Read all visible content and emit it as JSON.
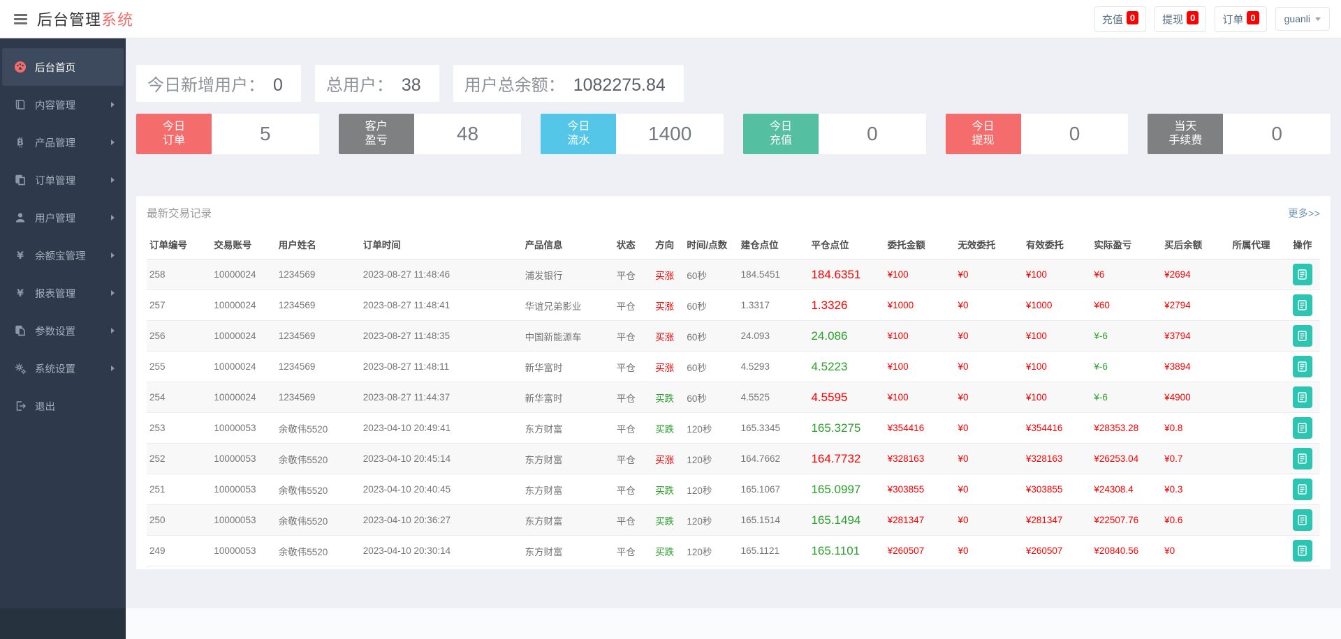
{
  "header": {
    "title_primary": "后台管理",
    "title_accent": "系统",
    "actions": [
      {
        "label": "充值",
        "badge": "0"
      },
      {
        "label": "提现",
        "badge": "0"
      },
      {
        "label": "订单",
        "badge": "0"
      }
    ],
    "user": "guanli"
  },
  "sidebar": {
    "items": [
      {
        "label": "后台首页",
        "icon": "dashboard-icon",
        "active": true,
        "arrow": false
      },
      {
        "label": "内容管理",
        "icon": "book-icon",
        "active": false,
        "arrow": true
      },
      {
        "label": "产品管理",
        "icon": "coin-icon",
        "active": false,
        "arrow": true
      },
      {
        "label": "订单管理",
        "icon": "orders-icon",
        "active": false,
        "arrow": true
      },
      {
        "label": "用户管理",
        "icon": "user-icon",
        "active": false,
        "arrow": true
      },
      {
        "label": "余额宝管理",
        "icon": "yuan-icon",
        "active": false,
        "arrow": true
      },
      {
        "label": "报表管理",
        "icon": "yuan-icon",
        "active": false,
        "arrow": true
      },
      {
        "label": "参数设置",
        "icon": "copy-icon",
        "active": false,
        "arrow": true
      },
      {
        "label": "系统设置",
        "icon": "gears-icon",
        "active": false,
        "arrow": true
      },
      {
        "label": "退出",
        "icon": "logout-icon",
        "active": false,
        "arrow": false
      }
    ]
  },
  "overview": {
    "stats": [
      {
        "label": "今日新增用户：",
        "value": "0"
      },
      {
        "label": "总用户：",
        "value": "38"
      },
      {
        "label": "用户总余额：",
        "value": "1082275.84"
      }
    ],
    "cards": [
      {
        "line1": "今日",
        "line2": "订单",
        "value": "5",
        "color": "#f56c6c"
      },
      {
        "line1": "客户",
        "line2": "盈亏",
        "value": "48",
        "color": "#7f8081"
      },
      {
        "line1": "今日",
        "line2": "流水",
        "value": "1400",
        "color": "#54c7e8"
      },
      {
        "line1": "今日",
        "line2": "充值",
        "value": "0",
        "color": "#55bfa2"
      },
      {
        "line1": "今日",
        "line2": "提现",
        "value": "0",
        "color": "#f56c6c"
      },
      {
        "line1": "当天",
        "line2": "手续费",
        "value": "0",
        "color": "#7f8081"
      }
    ]
  },
  "table": {
    "title": "最新交易记录",
    "more_link": "更多>>",
    "columns": [
      "订单编号",
      "交易账号",
      "用户姓名",
      "订单时间",
      "产品信息",
      "状态",
      "方向",
      "时间/点数",
      "建仓点位",
      "平仓点位",
      "委托金额",
      "无效委托",
      "有效委托",
      "实际盈亏",
      "买后余额",
      "所属代理",
      "操作"
    ],
    "rows": [
      {
        "id": "258",
        "account": "10000024",
        "name": "1234569",
        "time": "2023-08-27 11:48:46",
        "product": "浦发银行",
        "status": "平仓",
        "direction": "买涨",
        "trend": "red",
        "period": "60秒",
        "open": "184.5451",
        "close": "184.6351",
        "close_color": "red",
        "amount": "¥100",
        "invalid": "¥0",
        "valid": "¥100",
        "profit": "¥6",
        "profit_color": "red",
        "balance": "¥2694",
        "agent": ""
      },
      {
        "id": "257",
        "account": "10000024",
        "name": "1234569",
        "time": "2023-08-27 11:48:41",
        "product": "华谊兄弟影业",
        "status": "平仓",
        "direction": "买涨",
        "trend": "red",
        "period": "60秒",
        "open": "1.3317",
        "close": "1.3326",
        "close_color": "red",
        "amount": "¥1000",
        "invalid": "¥0",
        "valid": "¥1000",
        "profit": "¥60",
        "profit_color": "red",
        "balance": "¥2794",
        "agent": ""
      },
      {
        "id": "256",
        "account": "10000024",
        "name": "1234569",
        "time": "2023-08-27 11:48:35",
        "product": "中国新能源车",
        "status": "平仓",
        "direction": "买涨",
        "trend": "red",
        "period": "60秒",
        "open": "24.093",
        "close": "24.086",
        "close_color": "green",
        "amount": "¥100",
        "invalid": "¥0",
        "valid": "¥100",
        "profit": "¥-6",
        "profit_color": "green",
        "balance": "¥3794",
        "agent": ""
      },
      {
        "id": "255",
        "account": "10000024",
        "name": "1234569",
        "time": "2023-08-27 11:48:11",
        "product": "新华富时",
        "status": "平仓",
        "direction": "买涨",
        "trend": "red",
        "period": "60秒",
        "open": "4.5293",
        "close": "4.5223",
        "close_color": "green",
        "amount": "¥100",
        "invalid": "¥0",
        "valid": "¥100",
        "profit": "¥-6",
        "profit_color": "green",
        "balance": "¥3894",
        "agent": ""
      },
      {
        "id": "254",
        "account": "10000024",
        "name": "1234569",
        "time": "2023-08-27 11:44:37",
        "product": "新华富时",
        "status": "平仓",
        "direction": "买跌",
        "trend": "green",
        "period": "60秒",
        "open": "4.5525",
        "close": "4.5595",
        "close_color": "red",
        "amount": "¥100",
        "invalid": "¥0",
        "valid": "¥100",
        "profit": "¥-6",
        "profit_color": "green",
        "balance": "¥4900",
        "agent": ""
      },
      {
        "id": "253",
        "account": "10000053",
        "name": "余敬伟5520",
        "time": "2023-04-10 20:49:41",
        "product": "东方财富",
        "status": "平仓",
        "direction": "买跌",
        "trend": "green",
        "period": "120秒",
        "open": "165.3345",
        "close": "165.3275",
        "close_color": "green",
        "amount": "¥354416",
        "invalid": "¥0",
        "valid": "¥354416",
        "profit": "¥28353.28",
        "profit_color": "red",
        "balance": "¥0.8",
        "agent": ""
      },
      {
        "id": "252",
        "account": "10000053",
        "name": "余敬伟5520",
        "time": "2023-04-10 20:45:14",
        "product": "东方财富",
        "status": "平仓",
        "direction": "买涨",
        "trend": "red",
        "period": "120秒",
        "open": "164.7662",
        "close": "164.7732",
        "close_color": "red",
        "amount": "¥328163",
        "invalid": "¥0",
        "valid": "¥328163",
        "profit": "¥26253.04",
        "profit_color": "red",
        "balance": "¥0.7",
        "agent": ""
      },
      {
        "id": "251",
        "account": "10000053",
        "name": "余敬伟5520",
        "time": "2023-04-10 20:40:45",
        "product": "东方财富",
        "status": "平仓",
        "direction": "买跌",
        "trend": "green",
        "period": "120秒",
        "open": "165.1067",
        "close": "165.0997",
        "close_color": "green",
        "amount": "¥303855",
        "invalid": "¥0",
        "valid": "¥303855",
        "profit": "¥24308.4",
        "profit_color": "red",
        "balance": "¥0.3",
        "agent": ""
      },
      {
        "id": "250",
        "account": "10000053",
        "name": "余敬伟5520",
        "time": "2023-04-10 20:36:27",
        "product": "东方财富",
        "status": "平仓",
        "direction": "买跌",
        "trend": "green",
        "period": "120秒",
        "open": "165.1514",
        "close": "165.1494",
        "close_color": "green",
        "amount": "¥281347",
        "invalid": "¥0",
        "valid": "¥281347",
        "profit": "¥22507.76",
        "profit_color": "red",
        "balance": "¥0.6",
        "agent": ""
      },
      {
        "id": "249",
        "account": "10000053",
        "name": "余敬伟5520",
        "time": "2023-04-10 20:30:14",
        "product": "东方财富",
        "status": "平仓",
        "direction": "买跌",
        "trend": "green",
        "period": "120秒",
        "open": "165.1121",
        "close": "165.1101",
        "close_color": "green",
        "amount": "¥260507",
        "invalid": "¥0",
        "valid": "¥260507",
        "profit": "¥20840.56",
        "profit_color": "red",
        "balance": "¥0",
        "agent": ""
      }
    ]
  }
}
